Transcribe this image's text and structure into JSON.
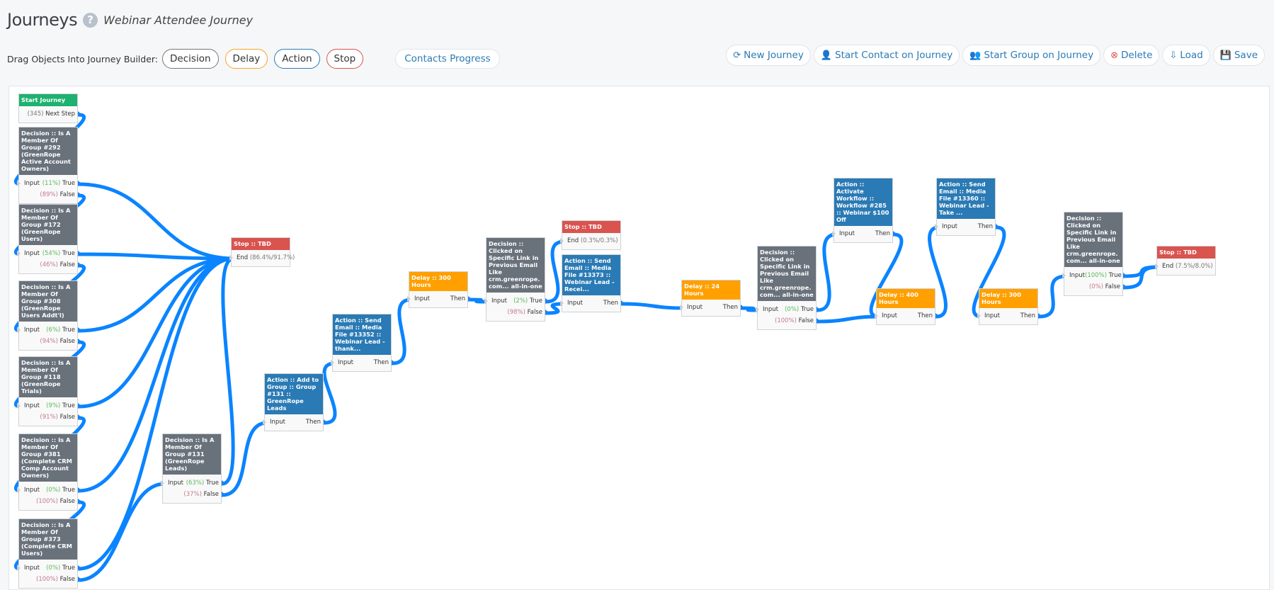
{
  "header": {
    "title": "Journeys",
    "help_icon": "?",
    "journey_name": "Webinar Attendee Journey"
  },
  "palette": {
    "drag_label": "Drag Objects Into Journey Builder:",
    "decision": "Decision",
    "delay": "Delay",
    "action": "Action",
    "stop": "Stop",
    "contacts_progress": "Contacts Progress"
  },
  "toolbar": [
    {
      "label": "New Journey",
      "icon": "refresh-icon",
      "glyph": "⟳"
    },
    {
      "label": "Start Contact on Journey",
      "icon": "user-icon",
      "glyph": "👤"
    },
    {
      "label": "Start Group on Journey",
      "icon": "group-icon",
      "glyph": "👥"
    },
    {
      "label": "Delete",
      "icon": "delete-circle-icon",
      "glyph": "⊗"
    },
    {
      "label": "Load",
      "icon": "load-icon",
      "glyph": "⇩"
    },
    {
      "label": "Save",
      "icon": "save-icon",
      "glyph": "💾"
    }
  ],
  "colors": {
    "start": "#1db26f",
    "decision": "#69717b",
    "action": "#2a7ab5",
    "delay": "#ffa000",
    "stop": "#d9534f",
    "connector": "#0a84ff"
  },
  "nodes": [
    {
      "id": "start",
      "type": "start",
      "title": "Start Journey",
      "count": "(345)",
      "next_label": "Next Step"
    },
    {
      "id": "d292",
      "type": "decision",
      "title": "Decision :: Is A Member Of Group #292 (GreenRope Active Account Owners)",
      "input_label": "Input",
      "true_pct": "(11%)",
      "true_label": "True",
      "false_pct": "(89%)",
      "false_label": "False"
    },
    {
      "id": "d172",
      "type": "decision",
      "title": "Decision :: Is A Member Of Group #172 (GreenRope Users)",
      "input_label": "Input",
      "true_pct": "(54%)",
      "true_label": "True",
      "false_pct": "(46%)",
      "false_label": "False"
    },
    {
      "id": "d308",
      "type": "decision",
      "title": "Decision :: Is A Member Of Group #308 (GreenRope Users Addt'l)",
      "input_label": "Input",
      "true_pct": "(6%)",
      "true_label": "True",
      "false_pct": "(94%)",
      "false_label": "False"
    },
    {
      "id": "d118",
      "type": "decision",
      "title": "Decision :: Is A Member Of Group #118 (GreenRope Trials)",
      "input_label": "Input",
      "true_pct": "(9%)",
      "true_label": "True",
      "false_pct": "(91%)",
      "false_label": "False"
    },
    {
      "id": "d381",
      "type": "decision",
      "title": "Decision :: Is A Member Of Group #381 (Complete CRM Comp Account Owners)",
      "input_label": "Input",
      "true_pct": "(0%)",
      "true_label": "True",
      "false_pct": "(100%)",
      "false_label": "False"
    },
    {
      "id": "d373",
      "type": "decision",
      "title": "Decision :: Is A Member Of Group #373 (Complete CRM Users)",
      "input_label": "Input",
      "true_pct": "(0%)",
      "true_label": "True",
      "false_pct": "(100%)",
      "false_label": "False"
    },
    {
      "id": "d131",
      "type": "decision",
      "title": "Decision :: Is A Member Of Group #131 (GreenRope Leads)",
      "input_label": "Input",
      "true_pct": "(63%)",
      "true_label": "True",
      "false_pct": "(37%)",
      "false_label": "False"
    },
    {
      "id": "stop1",
      "type": "stop",
      "title": "Stop :: TBD",
      "end_label": "End",
      "end_pct": "(86.4%/91.7%)"
    },
    {
      "id": "addgroup",
      "type": "action",
      "title": "Action :: Add to Group :: Group #131 :: GreenRope Leads",
      "input_label": "Input",
      "then_label": "Then"
    },
    {
      "id": "email13352",
      "type": "action",
      "title": "Action :: Send Email :: Media File #13352 :: Webinar Lead - thank...",
      "input_label": "Input",
      "then_label": "Then"
    },
    {
      "id": "delay300a",
      "type": "delay",
      "title": "Delay :: 300 Hours",
      "input_label": "Input",
      "then_label": "Then"
    },
    {
      "id": "click1",
      "type": "decision",
      "title": "Decision :: Clicked on Specific Link in Previous Email Like crm.greenrope.com... all-in-one",
      "input_label": "Input",
      "true_pct": "(2%)",
      "true_label": "True",
      "false_pct": "(98%)",
      "false_label": "False"
    },
    {
      "id": "stop2",
      "type": "stop",
      "title": "Stop :: TBD",
      "end_label": "End",
      "end_pct": "(0.3%/0.3%)"
    },
    {
      "id": "email13373",
      "type": "action",
      "title": "Action :: Send Email :: Media File #13373 :: Webinar Lead - Recei...",
      "input_label": "Input",
      "then_label": "Then"
    },
    {
      "id": "delay24",
      "type": "delay",
      "title": "Delay :: 24 Hours",
      "input_label": "Input",
      "then_label": "Then"
    },
    {
      "id": "click2",
      "type": "decision",
      "title": "Decision :: Clicked on Specific Link in Previous Email Like crm.greenrope.com... all-in-one",
      "input_label": "Input",
      "true_pct": "(0%)",
      "true_label": "True",
      "false_pct": "(100%)",
      "false_label": "False"
    },
    {
      "id": "workflow285",
      "type": "action",
      "title": "Action :: Activate Workflow :: Workflow #285 :: Webinar $100 Off",
      "input_label": "Input",
      "then_label": "Then"
    },
    {
      "id": "delay400",
      "type": "delay",
      "title": "Delay :: 400 Hours",
      "input_label": "Input",
      "then_label": "Then"
    },
    {
      "id": "email13360",
      "type": "action",
      "title": "Action :: Send Email :: Media File #13360 :: Webinar Lead - Take ...",
      "input_label": "Input",
      "then_label": "Then"
    },
    {
      "id": "delay300b",
      "type": "delay",
      "title": "Delay :: 300 Hours",
      "input_label": "Input",
      "then_label": "Then"
    },
    {
      "id": "click3",
      "type": "decision",
      "title": "Decision :: Clicked on Specific Link in Previous Email Like crm.greenrope.com... all-in-one",
      "input_label": "Input",
      "true_pct": "(100%)",
      "true_label": "True",
      "false_pct": "(0%)",
      "false_label": "False"
    },
    {
      "id": "stop3",
      "type": "stop",
      "title": "Stop :: TBD",
      "end_label": "End",
      "end_pct": "(7.5%/8.0%)"
    }
  ],
  "connections": [
    [
      "start.next",
      "d292"
    ],
    [
      "d292.true",
      "stop1"
    ],
    [
      "d292.false",
      "d172"
    ],
    [
      "d172.true",
      "stop1"
    ],
    [
      "d172.false",
      "d308"
    ],
    [
      "d308.true",
      "stop1"
    ],
    [
      "d308.false",
      "d118"
    ],
    [
      "d118.true",
      "stop1"
    ],
    [
      "d118.false",
      "d381"
    ],
    [
      "d381.true",
      "stop1"
    ],
    [
      "d381.false",
      "d373"
    ],
    [
      "d373.true",
      "stop1"
    ],
    [
      "d373.false",
      "d131"
    ],
    [
      "d131.true",
      "stop1"
    ],
    [
      "d131.false",
      "addgroup"
    ],
    [
      "addgroup.then",
      "email13352"
    ],
    [
      "email13352.then",
      "delay300a"
    ],
    [
      "delay300a.then",
      "click1"
    ],
    [
      "click1.true",
      "stop2"
    ],
    [
      "click1.false",
      "email13373"
    ],
    [
      "email13373.then",
      "delay24"
    ],
    [
      "delay24.then",
      "click2"
    ],
    [
      "click2.true",
      "workflow285"
    ],
    [
      "click2.false",
      "delay400"
    ],
    [
      "workflow285.then",
      "delay400"
    ],
    [
      "delay400.then",
      "email13360"
    ],
    [
      "email13360.then",
      "delay300b"
    ],
    [
      "delay300b.then",
      "click3"
    ],
    [
      "click3.true",
      "stop3"
    ],
    [
      "click3.false",
      "stop3"
    ]
  ]
}
